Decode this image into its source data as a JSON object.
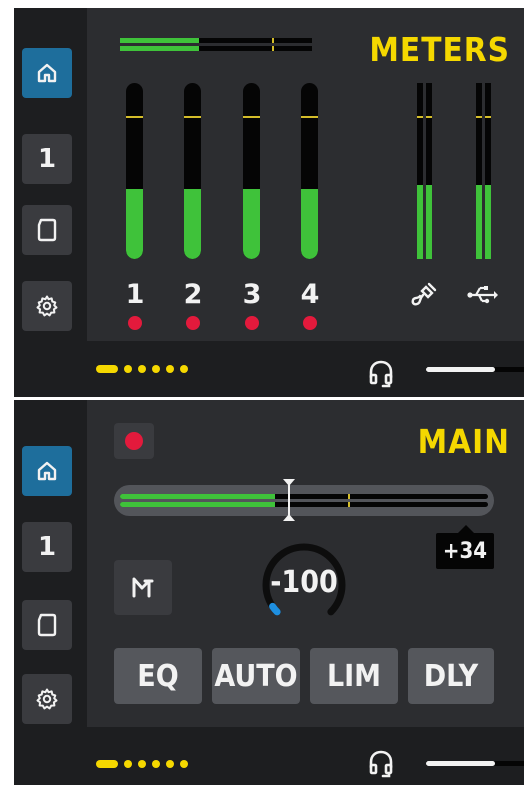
{
  "sidebar": {
    "items": [
      {
        "name": "home",
        "icon": "home-icon"
      },
      {
        "name": "channel",
        "label": "1"
      },
      {
        "name": "sd-card",
        "icon": "sd-card-icon"
      },
      {
        "name": "settings",
        "icon": "gear-icon"
      }
    ]
  },
  "meters_screen": {
    "title": "METERS",
    "channels": [
      {
        "label": "1",
        "level": 0.4,
        "peak": 0.8
      },
      {
        "label": "2",
        "level": 0.4,
        "peak": 0.8
      },
      {
        "label": "3",
        "level": 0.4,
        "peak": 0.8
      },
      {
        "label": "4",
        "level": 0.4,
        "peak": 0.8
      }
    ],
    "stereo_inputs": [
      {
        "icon": "mic-cable-icon",
        "level": 0.42,
        "peak": 0.8
      },
      {
        "icon": "usb-icon",
        "level": 0.42,
        "peak": 0.8
      }
    ],
    "top_level": 0.41,
    "top_peak": 0.79
  },
  "main_screen": {
    "title": "MAIN",
    "fader_level": 0.42,
    "fader_peak": 0.62,
    "fader_position": 0.46,
    "gain_label": "+34",
    "knob_value": "-100",
    "knob_fraction": 0.04,
    "fx_buttons": [
      "EQ",
      "AUTO",
      "LIM",
      "DLY"
    ]
  },
  "pager": {
    "pages": 6,
    "current": 1
  },
  "headphone_level": 0.7,
  "colors": {
    "accent": "#f5d800",
    "active": "#1e6e9c",
    "meter": "#3fc23a",
    "rec": "#e31a3c",
    "knob_indicator": "#1e8fe0"
  }
}
